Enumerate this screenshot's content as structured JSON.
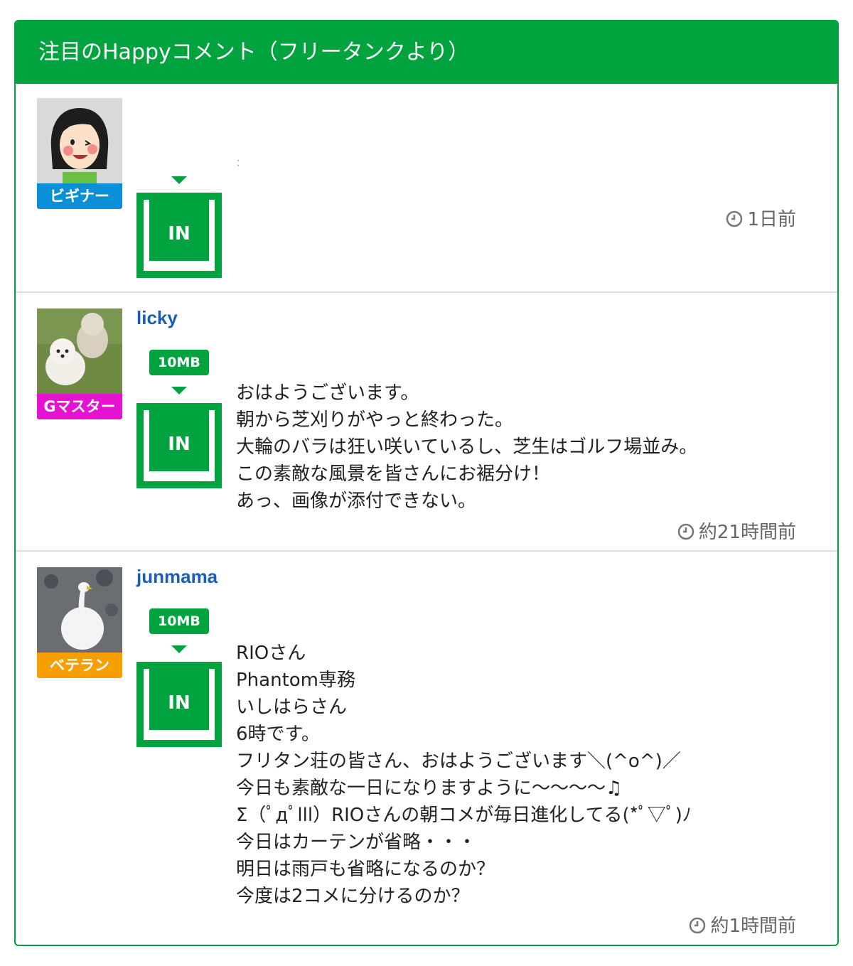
{
  "panel": {
    "title": "注目のHappyコメント（フリータンクより）"
  },
  "comments": [
    {
      "username": "",
      "rank": "ビギナー",
      "rank_color": "#0b8fd6",
      "avatar_icon": "woman-avatar-icon",
      "size_label": "",
      "in_label": "IN",
      "body": ":",
      "timestamp": "1日前"
    },
    {
      "username": "licky",
      "rank": "Gマスター",
      "rank_color": "#e612d2",
      "avatar_icon": "dogs-photo",
      "size_label": "10MB",
      "in_label": "IN",
      "body": "おはようございます。\n朝から芝刈りがやっと終わった。\n大輪のバラは狂い咲いているし、芝生はゴルフ場並み。\nこの素敵な風景を皆さんにお裾分け！\nあっ、画像が添付できない。",
      "timestamp": "約21時間前"
    },
    {
      "username": "junmama",
      "rank": "ベテラン",
      "rank_color": "#f5a000",
      "avatar_icon": "swan-photo",
      "size_label": "10MB",
      "in_label": "IN",
      "body": "RIOさん\nPhantom専務\nいしはらさん\n6時です。\nフリタン荘の皆さん、おはようございます＼(^o^)／\n今日も素敵な一日になりますように〜〜〜〜♫\nΣ（ﾟдﾟlll）RIOさんの朝コメが毎日進化してる(*ﾟ▽ﾟ)ﾉ\n今日はカーテンが省略・・・\n明日は雨戸も省略になるのか？\n今度は2コメに分けるのか？",
      "timestamp": "約1時間前"
    }
  ],
  "colors": {
    "accent": "#00a33e",
    "username": "#1a5fb4"
  }
}
